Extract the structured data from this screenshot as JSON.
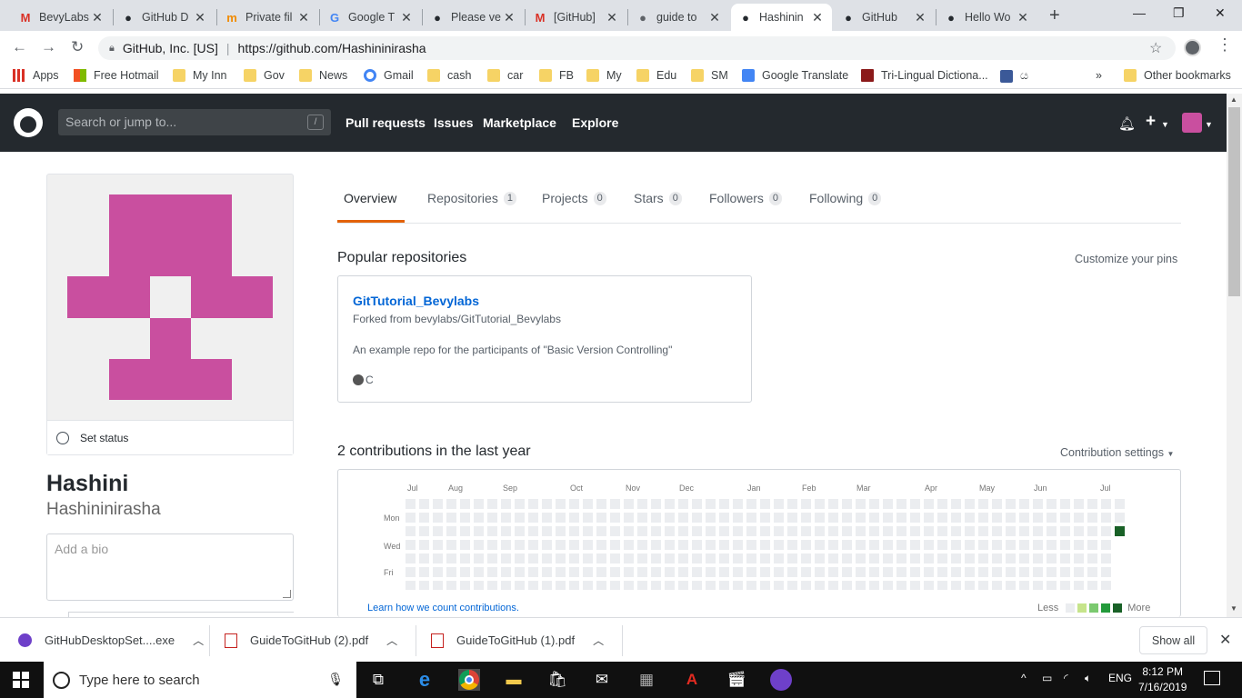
{
  "browser": {
    "tabs": [
      {
        "title": "BevyLabs",
        "icon": "gmail-icon",
        "icon_char": "M",
        "icon_color": "#d93025"
      },
      {
        "title": "GitHub D",
        "icon": "github-icon",
        "icon_char": "●",
        "icon_color": "#24292e"
      },
      {
        "title": "Private fil",
        "icon": "mh-icon",
        "icon_char": "m",
        "icon_color": "#f08a00"
      },
      {
        "title": "Google T",
        "icon": "google-translate-icon",
        "icon_char": "G",
        "icon_color": "#4285f4"
      },
      {
        "title": "Please ve",
        "icon": "github-icon",
        "icon_char": "●",
        "icon_color": "#24292e"
      },
      {
        "title": "[GitHub]",
        "icon": "gmail-icon",
        "icon_char": "M",
        "icon_color": "#d93025"
      },
      {
        "title": "guide to",
        "icon": "globe-icon",
        "icon_char": "●",
        "icon_color": "#5f6368"
      },
      {
        "title": "Hashinin",
        "icon": "github-icon",
        "icon_char": "●",
        "icon_color": "#24292e",
        "active": true
      },
      {
        "title": "GitHub",
        "icon": "github-icon",
        "icon_char": "●",
        "icon_color": "#24292e"
      },
      {
        "title": "Hello Wo",
        "icon": "github-icon",
        "icon_char": "●",
        "icon_color": "#24292e"
      }
    ],
    "new_tab": "+",
    "window_controls": {
      "minimize": "—",
      "maximize": "❐",
      "close": "✕"
    },
    "address": {
      "org": "GitHub, Inc. [US]",
      "url": "https://github.com/Hashininirasha"
    },
    "bookmarks": [
      {
        "label": "Apps",
        "icon": "apps-icon"
      },
      {
        "label": "Free Hotmail",
        "icon": "windows-icon"
      },
      {
        "label": "My Inn",
        "icon": "folder-icon"
      },
      {
        "label": "Gov",
        "icon": "folder-icon"
      },
      {
        "label": "News",
        "icon": "folder-icon"
      },
      {
        "label": "Gmail",
        "icon": "google-icon"
      },
      {
        "label": "cash",
        "icon": "folder-icon"
      },
      {
        "label": "car",
        "icon": "folder-icon"
      },
      {
        "label": "FB",
        "icon": "folder-icon"
      },
      {
        "label": "My",
        "icon": "folder-icon"
      },
      {
        "label": "Edu",
        "icon": "folder-icon"
      },
      {
        "label": "SM",
        "icon": "folder-icon"
      },
      {
        "label": "Google Translate",
        "icon": "google-translate-icon"
      },
      {
        "label": "Tri-Lingual Dictiona...",
        "icon": "book-icon"
      },
      {
        "label": "ය",
        "icon": "facebook-icon"
      }
    ],
    "bookmarks_overflow": "»",
    "other_bookmarks": "Other bookmarks"
  },
  "github_header": {
    "search_placeholder": "Search or jump to...",
    "search_shortcut": "/",
    "nav": [
      "Pull requests",
      "Issues",
      "Marketplace",
      "Explore"
    ]
  },
  "profile": {
    "set_status": "Set status",
    "name": "Hashini",
    "login": "Hashininirasha",
    "bio_placeholder": "Add a bio",
    "avatar_color": "#c94f9f"
  },
  "tabs": [
    {
      "label": "Overview",
      "count": null,
      "selected": true
    },
    {
      "label": "Repositories",
      "count": "1"
    },
    {
      "label": "Projects",
      "count": "0"
    },
    {
      "label": "Stars",
      "count": "0"
    },
    {
      "label": "Followers",
      "count": "0"
    },
    {
      "label": "Following",
      "count": "0"
    }
  ],
  "popular": {
    "title": "Popular repositories",
    "customize": "Customize your pins",
    "repo": {
      "name": "GitTutorial_Bevylabs",
      "forked_from": "Forked from bevylabs/GitTutorial_Bevylabs",
      "description": "An example repo for the participants of \"Basic Version Controlling\"",
      "language": "C"
    }
  },
  "contributions": {
    "title": "2 contributions in the last year",
    "settings": "Contribution settings",
    "months": [
      "Jul",
      "Aug",
      "Sep",
      "Oct",
      "Nov",
      "Dec",
      "Jan",
      "Feb",
      "Mar",
      "Apr",
      "May",
      "Jun",
      "Jul"
    ],
    "weekdays": [
      "Mon",
      "Wed",
      "Fri"
    ],
    "learn": "Learn how we count contributions.",
    "legend_less": "Less",
    "legend_more": "More",
    "legend_colors": [
      "#ebedf0",
      "#c6e48b",
      "#7bc96f",
      "#239a3b",
      "#196127"
    ],
    "empty_color": "#ebedf0",
    "active_color": "#196127"
  },
  "downloads": [
    {
      "name": "GitHubDesktopSet....exe",
      "icon": "github-desktop-icon"
    },
    {
      "name": "GuideToGitHub (2).pdf",
      "icon": "pdf-icon"
    },
    {
      "name": "GuideToGitHub (1).pdf",
      "icon": "pdf-icon"
    }
  ],
  "downloads_show_all": "Show all",
  "taskbar": {
    "search_placeholder": "Type here to search",
    "lang": "ENG",
    "time": "8:12 PM",
    "date": "7/16/2019"
  }
}
